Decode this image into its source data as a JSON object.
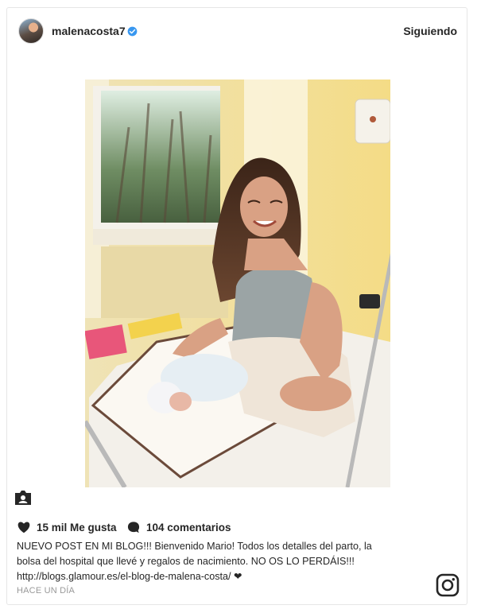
{
  "post": {
    "username": "malenacosta7",
    "follow_label": "Siguiendo",
    "likes_label": "15 mil Me gusta",
    "comments_label": "104 comentarios",
    "caption_line1": "NUEVO POST EN MI BLOG!!! Bienvenido Mario! Todos los detalles del parto, la",
    "caption_line2": "bolsa del hospital que llevé y regalos de nacimiento. NO OS LO PERDÁIS!!!",
    "caption_link": "http://blogs.glamour.es/el-blog-de-malena-costa/",
    "caption_heart": "❤",
    "timestamp": "HACE UN DÍA"
  },
  "icons": {
    "verified": "verified-badge-icon",
    "like": "heart-icon",
    "comment": "comment-bubble-icon",
    "tag": "user-tag-icon",
    "platform": "instagram-logo-icon"
  },
  "colors": {
    "verified_blue": "#3897f0",
    "text": "#262626",
    "muted": "#999999"
  }
}
